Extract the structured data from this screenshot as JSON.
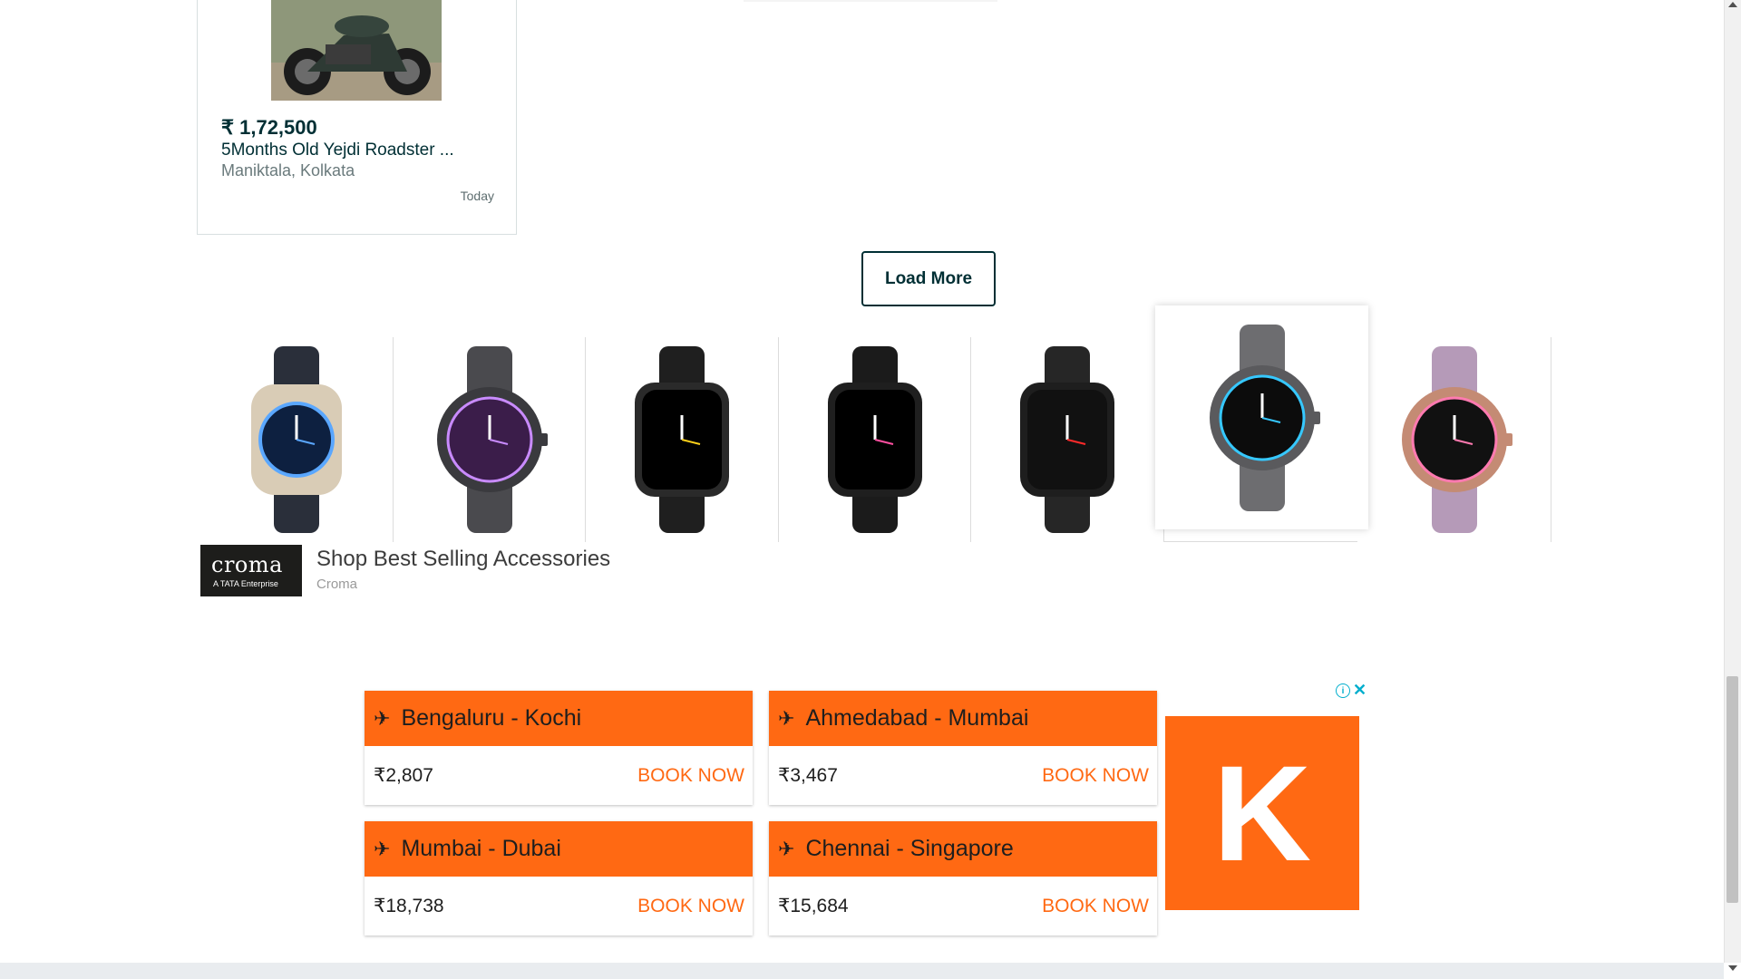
{
  "listing": {
    "price": "₹ 1,72,500",
    "title": "5Months Old Yejdi Roadster ...",
    "location": "Maniktala, Kolkata",
    "date": "Today"
  },
  "load_more_label": "Load More",
  "shopping_ad": {
    "logo_text": "croma",
    "logo_subtext": "A TATA Enterprise",
    "title": "Shop Best Selling Accessories",
    "source": "Croma",
    "products": [
      {
        "name": "smartwatch-ultra",
        "strap": "#2a2f3a",
        "case": "#d9ccb6",
        "dial": "#0d2040",
        "accent": "#5aa7ff"
      },
      {
        "name": "steel-chronograph",
        "strap": "#4a4a4e",
        "case": "#3a3a3e",
        "dial": "#3b1d4a",
        "accent": "#c98bff"
      },
      {
        "name": "square-smartwatch-yellow",
        "strap": "#1f1f1f",
        "case": "#2a2a2a",
        "dial": "#000000",
        "accent": "#ffd21a"
      },
      {
        "name": "square-smartwatch-analog",
        "strap": "#1b1b1b",
        "case": "#1f1f1f",
        "dial": "#000000",
        "accent": "#ff4fa0"
      },
      {
        "name": "square-smartwatch-24",
        "strap": "#262626",
        "case": "#1e1e1e",
        "dial": "#111111",
        "accent": "#ff2a2a"
      },
      {
        "name": "fossil-gen6-smoke",
        "strap": "#6d6d70",
        "case": "#5a5a5d",
        "dial": "#0c0c0c",
        "accent": "#36c8ff"
      },
      {
        "name": "fossil-gen6-rose",
        "strap": "#b59ab8",
        "case": "#c48b74",
        "dial": "#111111",
        "accent": "#ff7ab0"
      }
    ]
  },
  "flights_ad": {
    "brand_letter": "K",
    "brand_color": "#ff6913",
    "info_icon": "i",
    "close_icon": "✕",
    "items": [
      {
        "route": "Bengaluru - Kochi",
        "price": "₹2,807",
        "cta": "BOOK NOW"
      },
      {
        "route": "Ahmedabad - Mumbai",
        "price": "₹3,467",
        "cta": "BOOK NOW"
      },
      {
        "route": "Mumbai - Dubai",
        "price": "₹18,738",
        "cta": "BOOK NOW"
      },
      {
        "route": "Chennai - Singapore",
        "price": "₹15,684",
        "cta": "BOOK NOW"
      }
    ]
  }
}
